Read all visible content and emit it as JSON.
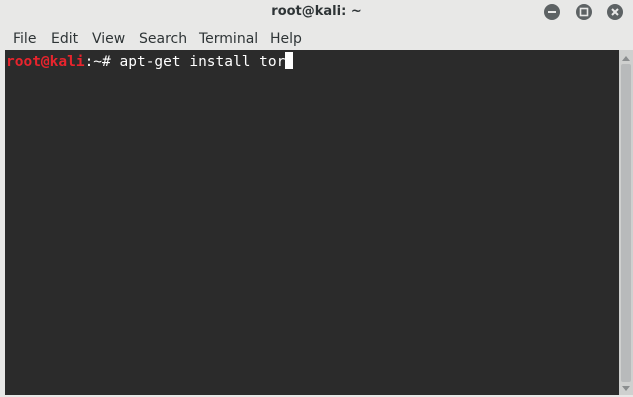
{
  "window": {
    "title": "root@kali: ~"
  },
  "menu": {
    "items": [
      "File",
      "Edit",
      "View",
      "Search",
      "Terminal",
      "Help"
    ]
  },
  "terminal": {
    "prompt_user_host": "root@kali",
    "prompt_path": ":~# ",
    "command": "apt-get install tor"
  },
  "colors": {
    "terminal_bg": "#2b2b2b",
    "prompt_user": "#e8242d",
    "text": "#ffffff",
    "chrome_bg": "#e8e8e7"
  },
  "icons": {
    "minimize": "minimize-icon",
    "maximize": "maximize-icon",
    "close": "close-icon"
  }
}
